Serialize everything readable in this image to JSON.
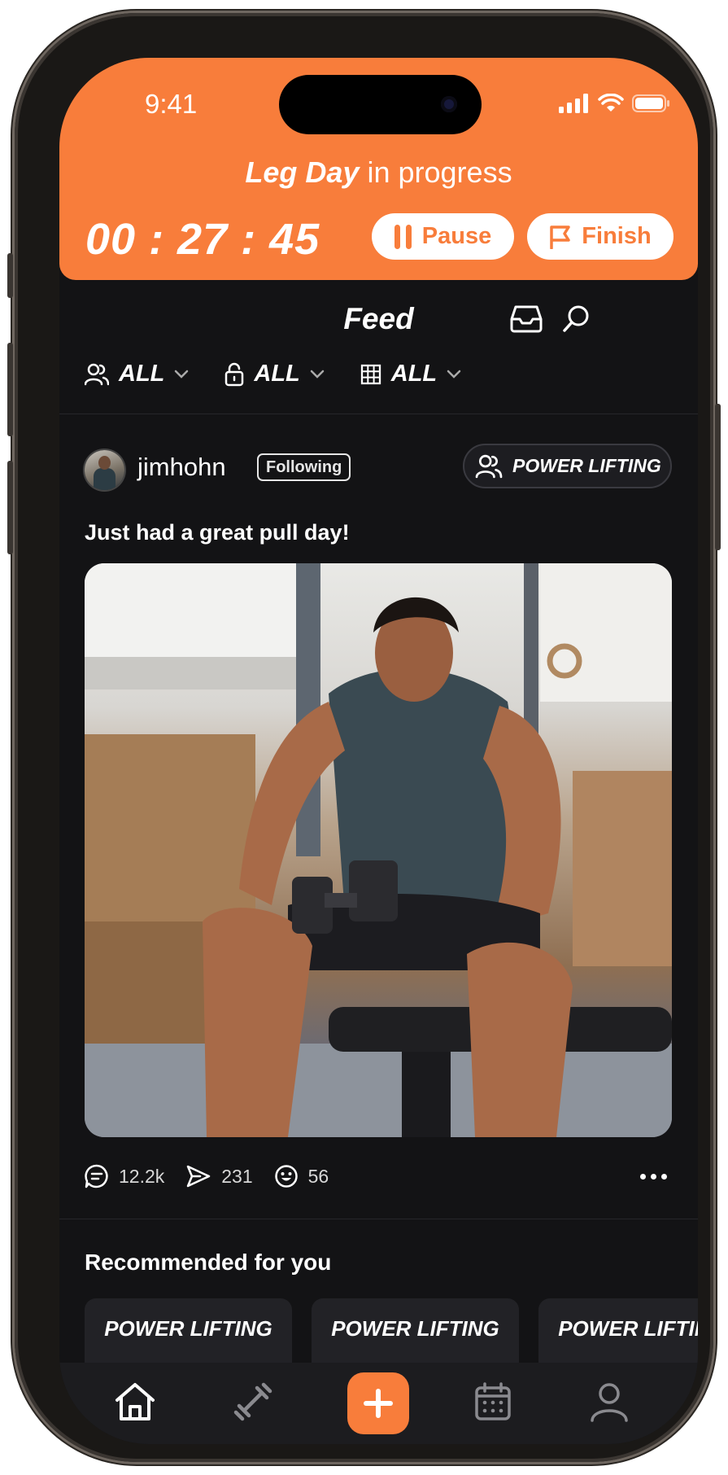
{
  "status_bar": {
    "time": "9:41"
  },
  "workout_banner": {
    "workout_name": "Leg Day",
    "status_text": "in progress",
    "timer": "00 : 27 : 45",
    "pause_label": "Pause",
    "finish_label": "Finish",
    "accent_color": "#f87d3b"
  },
  "feed_header": {
    "title": "Feed",
    "filters": [
      {
        "icon": "users-icon",
        "label": "ALL"
      },
      {
        "icon": "lock-icon",
        "label": "ALL"
      },
      {
        "icon": "grid-icon",
        "label": "ALL"
      }
    ]
  },
  "post": {
    "username": "jimhohn",
    "follow_status": "Following",
    "group": "POWER LIFTING",
    "text": "Just had a great pull day!",
    "comments": "12.2k",
    "shares": "231",
    "reactions": "56"
  },
  "recommended": {
    "title": "Recommended for you",
    "cards": [
      {
        "label": "POWER LIFTING"
      },
      {
        "label": "POWER LIFTING"
      },
      {
        "label": "POWER LIFTING"
      }
    ]
  },
  "tab_bar": {
    "tabs": [
      "home-icon",
      "dumbbell-icon",
      "add-icon",
      "calendar-icon",
      "profile-icon"
    ]
  }
}
